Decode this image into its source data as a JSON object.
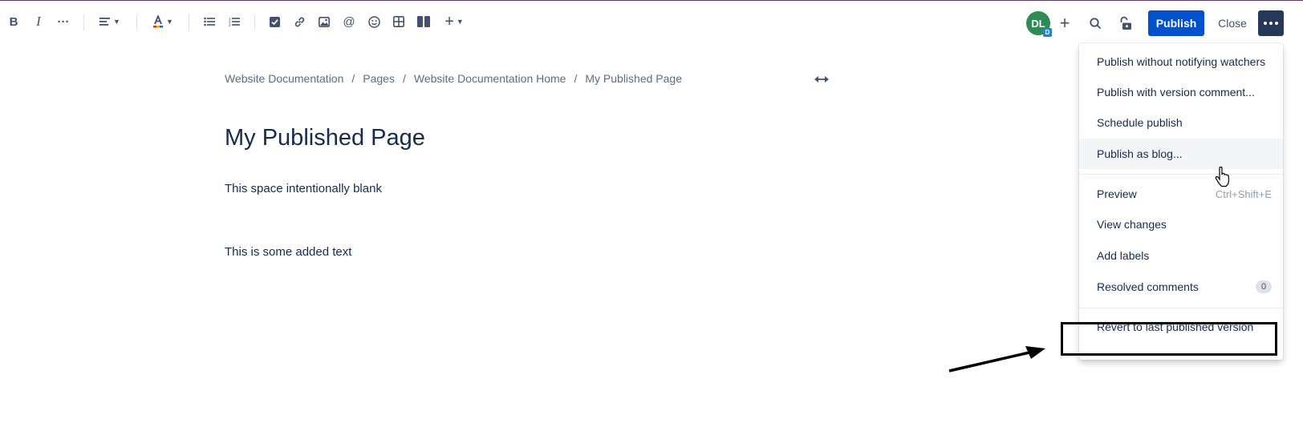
{
  "toolbar": {
    "bold": "B",
    "italic": "I",
    "more_formatting": "···",
    "insert_plus": "+"
  },
  "header": {
    "avatar_initials": "DL",
    "avatar_badge": "D",
    "publish_label": "Publish",
    "close_label": "Close"
  },
  "breadcrumb": {
    "items": [
      "Website Documentation",
      "Pages",
      "Website Documentation Home",
      "My Published Page"
    ],
    "separator": "/"
  },
  "page": {
    "title": "My Published Page",
    "paragraphs": [
      "This space intentionally blank",
      "This is some added text"
    ]
  },
  "menu": {
    "items": [
      {
        "label": "Publish without notifying watchers"
      },
      {
        "label": "Publish with version comment..."
      },
      {
        "label": "Schedule publish"
      },
      {
        "label": "Publish as blog..."
      },
      {
        "label": "Preview",
        "shortcut": "Ctrl+Shift+E"
      },
      {
        "label": "View changes"
      },
      {
        "label": "Add labels"
      },
      {
        "label": "Resolved comments",
        "count": "0"
      },
      {
        "label": "Revert to last published version"
      }
    ]
  },
  "colors": {
    "primary": "#0052cc",
    "more_button": "#253858",
    "avatar": "#2e8b57",
    "text": "#172b4d"
  },
  "icons": [
    "bold-icon",
    "italic-icon",
    "more-formatting-icon",
    "align-icon",
    "text-color-icon",
    "bullet-list-icon",
    "numbered-list-icon",
    "action-item-icon",
    "link-icon",
    "image-icon",
    "mention-icon",
    "emoji-icon",
    "table-icon",
    "layouts-icon",
    "insert-plus-icon",
    "search-icon",
    "lock-icon",
    "more-icon",
    "expand-width-icon",
    "pointer-cursor-icon",
    "arrow-annotation"
  ]
}
